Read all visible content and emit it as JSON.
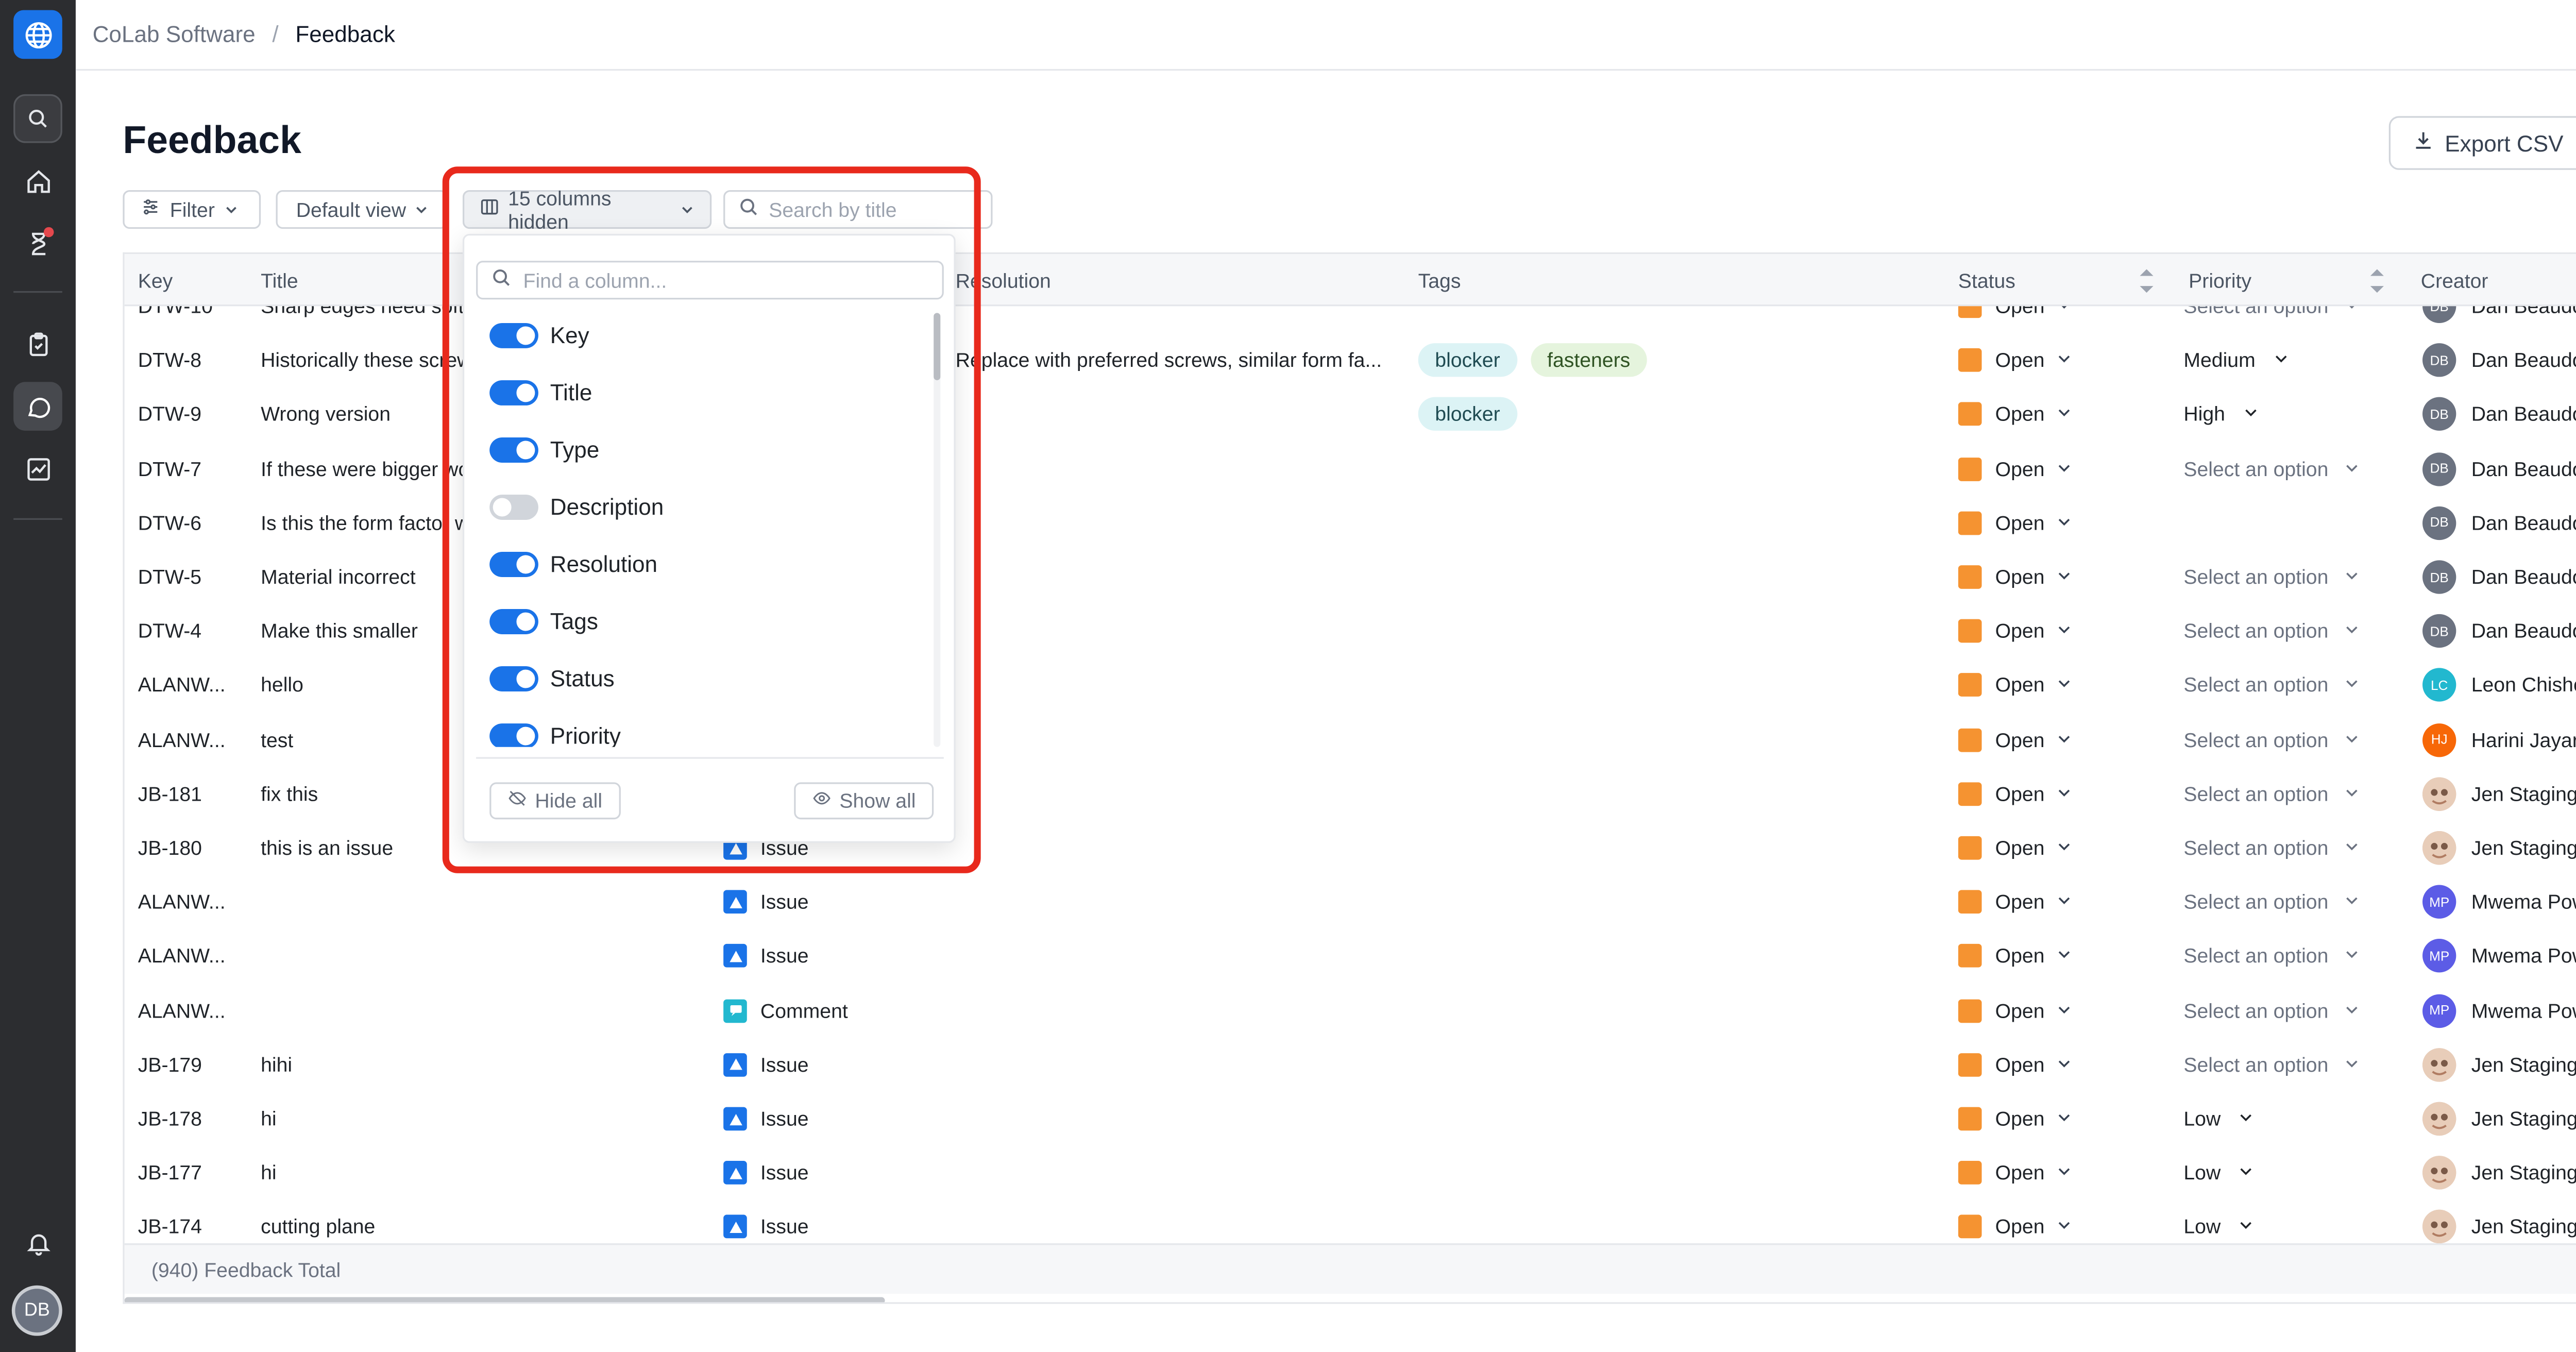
{
  "breadcrumb": {
    "org": "CoLab Software",
    "separator": "/",
    "current": "Feedback"
  },
  "page": {
    "title": "Feedback"
  },
  "toolbar": {
    "export_label": "Export CSV",
    "filter_label": "Filter",
    "view_label": "Default view",
    "columns_label": "15 columns hidden",
    "search_placeholder": "Search by title"
  },
  "columns_menu": {
    "find_placeholder": "Find a column...",
    "items": [
      {
        "label": "Key",
        "on": true
      },
      {
        "label": "Title",
        "on": true
      },
      {
        "label": "Type",
        "on": true
      },
      {
        "label": "Description",
        "on": false
      },
      {
        "label": "Resolution",
        "on": true
      },
      {
        "label": "Tags",
        "on": true
      },
      {
        "label": "Status",
        "on": true
      },
      {
        "label": "Priority",
        "on": true
      }
    ],
    "hide_all_label": "Hide all",
    "show_all_label": "Show all"
  },
  "table": {
    "headers": {
      "key": "Key",
      "title": "Title",
      "resolution": "Resolution",
      "tags": "Tags",
      "status": "Status",
      "priority": "Priority",
      "creator": "Creator"
    },
    "rows": [
      {
        "key": "DTW-10",
        "title": "Sharp edges need soft",
        "type": "",
        "resolution": "",
        "tags": [],
        "status": "Open",
        "priority": "Select an option",
        "creator": "Dan Beaudoin",
        "initials": "DB",
        "avatar_color": "#6b7280"
      },
      {
        "key": "DTW-8",
        "title": "Historically these screws",
        "type": "",
        "resolution": "Replace with preferred screws, similar form fa...",
        "tags": [
          "blocker",
          "fasteners"
        ],
        "status": "Open",
        "priority": "Medium",
        "creator": "Dan Beaudoin",
        "initials": "DB",
        "avatar_color": "#6b7280"
      },
      {
        "key": "DTW-9",
        "title": "Wrong version",
        "type": "",
        "resolution": "",
        "tags": [
          "blocker"
        ],
        "status": "Open",
        "priority": "High",
        "creator": "Dan Beaudoin",
        "initials": "DB",
        "avatar_color": "#6b7280"
      },
      {
        "key": "DTW-7",
        "title": "If these were bigger wo",
        "type": "",
        "resolution": "",
        "tags": [],
        "status": "Open",
        "priority": "Select an option",
        "creator": "Dan Beaudoin",
        "initials": "DB",
        "avatar_color": "#6b7280"
      },
      {
        "key": "DTW-6",
        "title": "Is this the form factor w",
        "type": "",
        "resolution": "",
        "tags": [],
        "status": "Open",
        "priority": "",
        "creator": "Dan Beaudoin",
        "initials": "DB",
        "avatar_color": "#6b7280"
      },
      {
        "key": "DTW-5",
        "title": "Material incorrect",
        "type": "",
        "resolution": "",
        "tags": [],
        "status": "Open",
        "priority": "Select an option",
        "creator": "Dan Beaudoin",
        "initials": "DB",
        "avatar_color": "#6b7280"
      },
      {
        "key": "DTW-4",
        "title": "Make this smaller",
        "type": "",
        "resolution": "",
        "tags": [],
        "status": "Open",
        "priority": "Select an option",
        "creator": "Dan Beaudoin",
        "initials": "DB",
        "avatar_color": "#6b7280"
      },
      {
        "key": "ALANW...",
        "title": "hello",
        "type": "",
        "resolution": "",
        "tags": [],
        "status": "Open",
        "priority": "Select an option",
        "creator": "Leon Chisholm",
        "initials": "LC",
        "avatar_color": "#22b8cf"
      },
      {
        "key": "ALANW...",
        "title": "test",
        "type": "",
        "resolution": "",
        "tags": [],
        "status": "Open",
        "priority": "Select an option",
        "creator": "Harini Jayaraman",
        "initials": "HJ",
        "avatar_color": "#f76707"
      },
      {
        "key": "JB-181",
        "title": "fix this",
        "type": "",
        "resolution": "",
        "tags": [],
        "status": "Open",
        "priority": "Select an option",
        "creator": "Jen Staging",
        "initials": "",
        "avatar_color": "#d9b8a3"
      },
      {
        "key": "JB-180",
        "title": "this is an issue",
        "type": "Issue",
        "resolution": "",
        "tags": [],
        "status": "Open",
        "priority": "Select an option",
        "creator": "Jen Staging",
        "initials": "",
        "avatar_color": "#d9b8a3"
      },
      {
        "key": "ALANW...",
        "title": "",
        "type": "Issue",
        "resolution": "",
        "tags": [],
        "status": "Open",
        "priority": "Select an option",
        "creator": "Mwema Powa",
        "initials": "MP",
        "avatar_color": "#5c5ce6"
      },
      {
        "key": "ALANW...",
        "title": "",
        "type": "Issue",
        "resolution": "",
        "tags": [],
        "status": "Open",
        "priority": "Select an option",
        "creator": "Mwema Powa",
        "initials": "MP",
        "avatar_color": "#5c5ce6"
      },
      {
        "key": "ALANW...",
        "title": "",
        "type": "Comment",
        "resolution": "",
        "tags": [],
        "status": "Open",
        "priority": "Select an option",
        "creator": "Mwema Powa",
        "initials": "MP",
        "avatar_color": "#5c5ce6"
      },
      {
        "key": "JB-179",
        "title": "hihi",
        "type": "Issue",
        "resolution": "",
        "tags": [],
        "status": "Open",
        "priority": "Select an option",
        "creator": "Jen Staging",
        "initials": "",
        "avatar_color": "#d9b8a3"
      },
      {
        "key": "JB-178",
        "title": "hi",
        "type": "Issue",
        "resolution": "",
        "tags": [],
        "status": "Open",
        "priority": "Low",
        "creator": "Jen Staging",
        "initials": "",
        "avatar_color": "#d9b8a3"
      },
      {
        "key": "JB-177",
        "title": "hi",
        "type": "Issue",
        "resolution": "",
        "tags": [],
        "status": "Open",
        "priority": "Low",
        "creator": "Jen Staging",
        "initials": "",
        "avatar_color": "#d9b8a3"
      },
      {
        "key": "JB-174",
        "title": "cutting plane",
        "type": "Issue",
        "resolution": "",
        "tags": [],
        "status": "Open",
        "priority": "Low",
        "creator": "Jen Staging",
        "initials": "",
        "avatar_color": "#d9b8a3"
      }
    ],
    "footer": "(940) Feedback Total"
  },
  "user": {
    "initials": "DB"
  },
  "colors": {
    "accent": "#1a73e8",
    "status_open": "#f59331",
    "sidebar": "#2c2d30",
    "highlight": "#e8291c"
  },
  "icons": [
    "globe-icon",
    "search-icon",
    "home-icon",
    "hourglass-icon",
    "clipboard-icon",
    "chat-icon",
    "chart-icon",
    "bell-icon",
    "download-icon",
    "sliders-icon",
    "chevron-down-icon",
    "columns-icon",
    "eye-off-icon",
    "eye-icon",
    "issue-icon",
    "comment-icon"
  ]
}
